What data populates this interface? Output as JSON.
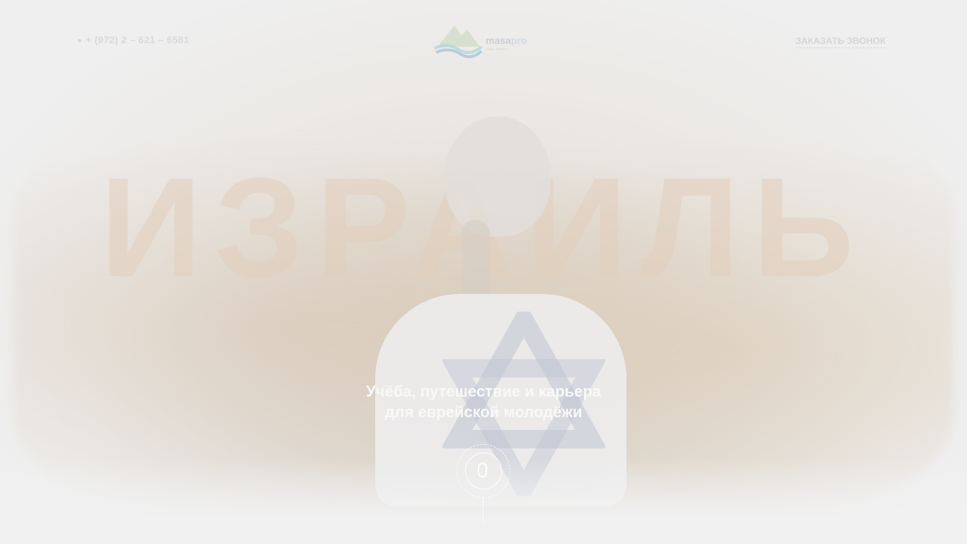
{
  "header": {
    "phone": "+ (972) 2 – 621 – 6581",
    "logo": {
      "name_part1": "masa",
      "name_part2": "pro",
      "tagline": "Israel Journey"
    },
    "callback_label": "Заказать звонок"
  },
  "hero": {
    "title": "ИЗРАИЛЬ",
    "subtitle_line1": "Учёба, путешествие и карьера",
    "subtitle_line2": "для еврейской молодёжи"
  },
  "icons": {
    "phone": "phone-icon",
    "logo": "masa-logo-icon",
    "scroll": "mouse-scroll-icon",
    "star": "star-of-david-icon"
  },
  "colors": {
    "background": "#eeeeee",
    "title_tint": "#e2cdbc",
    "subtitle": "#f8f8f8"
  }
}
